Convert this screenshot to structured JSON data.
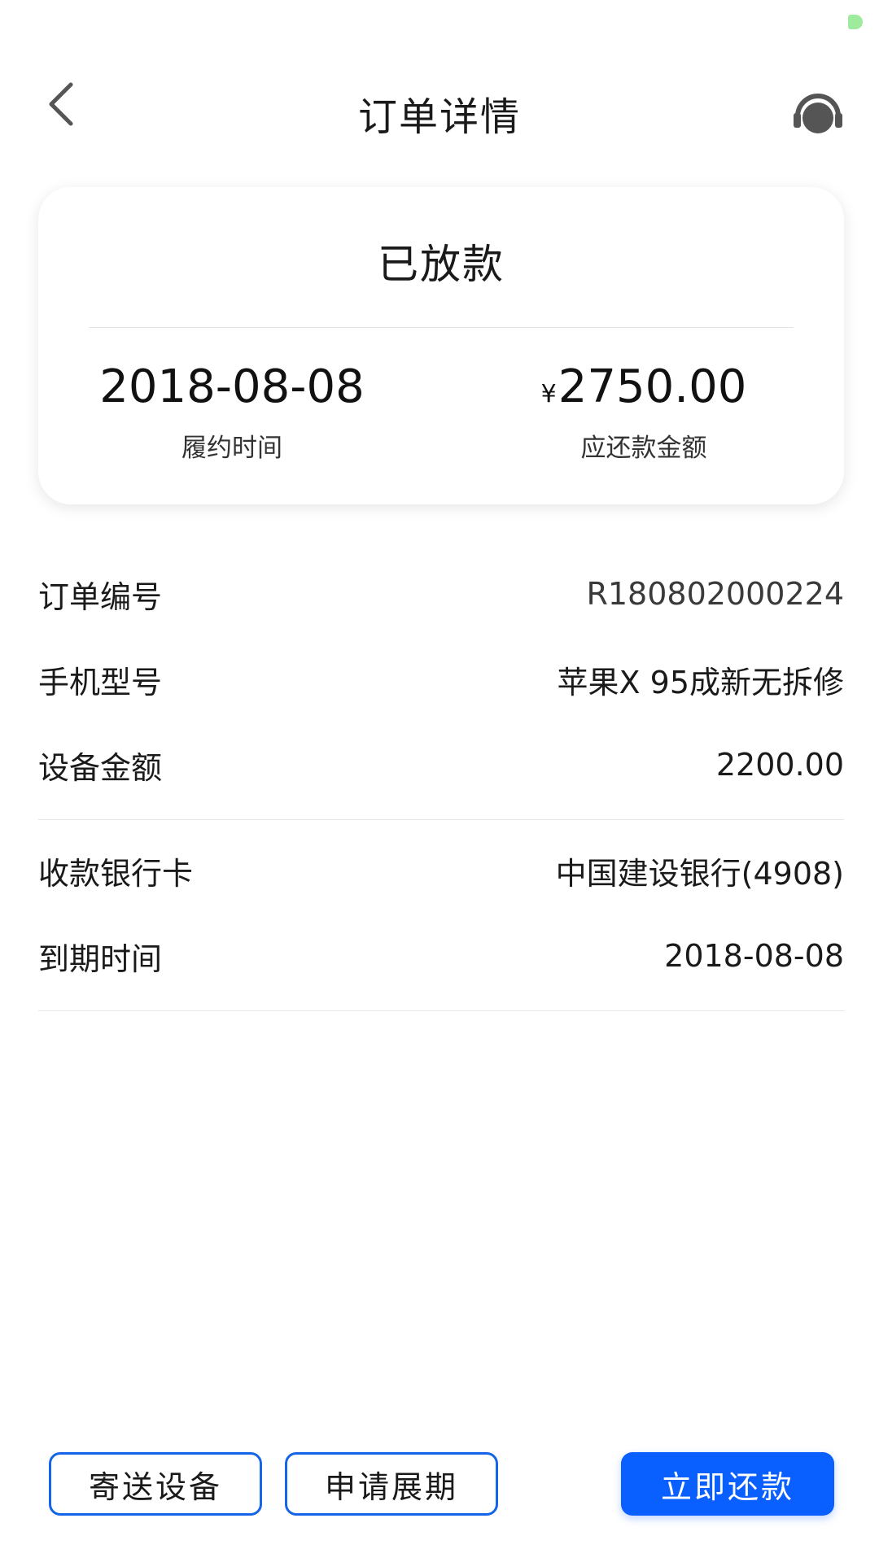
{
  "header": {
    "title": "订单详情",
    "back_icon": "chevron-left-icon",
    "support_icon": "headset-icon"
  },
  "summary": {
    "status": "已放款",
    "date_value": "2018-08-08",
    "date_label": "履约时间",
    "currency_symbol": "¥",
    "amount_value": "2750.00",
    "amount_label": "应还款金额"
  },
  "details": {
    "order_no_label": "订单编号",
    "order_no_value": "R180802000224",
    "phone_model_label": "手机型号",
    "phone_model_value": "苹果X 95成新无拆修",
    "device_amount_label": "设备金额",
    "device_amount_value": "2200.00",
    "bank_card_label": "收款银行卡",
    "bank_card_value": "中国建设银行(4908)",
    "due_date_label": "到期时间",
    "due_date_value": "2018-08-08"
  },
  "actions": {
    "send_device": "寄送设备",
    "apply_extension": "申请展期",
    "repay_now": "立即还款"
  },
  "colors": {
    "primary": "#0a5fff",
    "outline": "#1565e8",
    "status_indicator": "#9eeb9e"
  }
}
